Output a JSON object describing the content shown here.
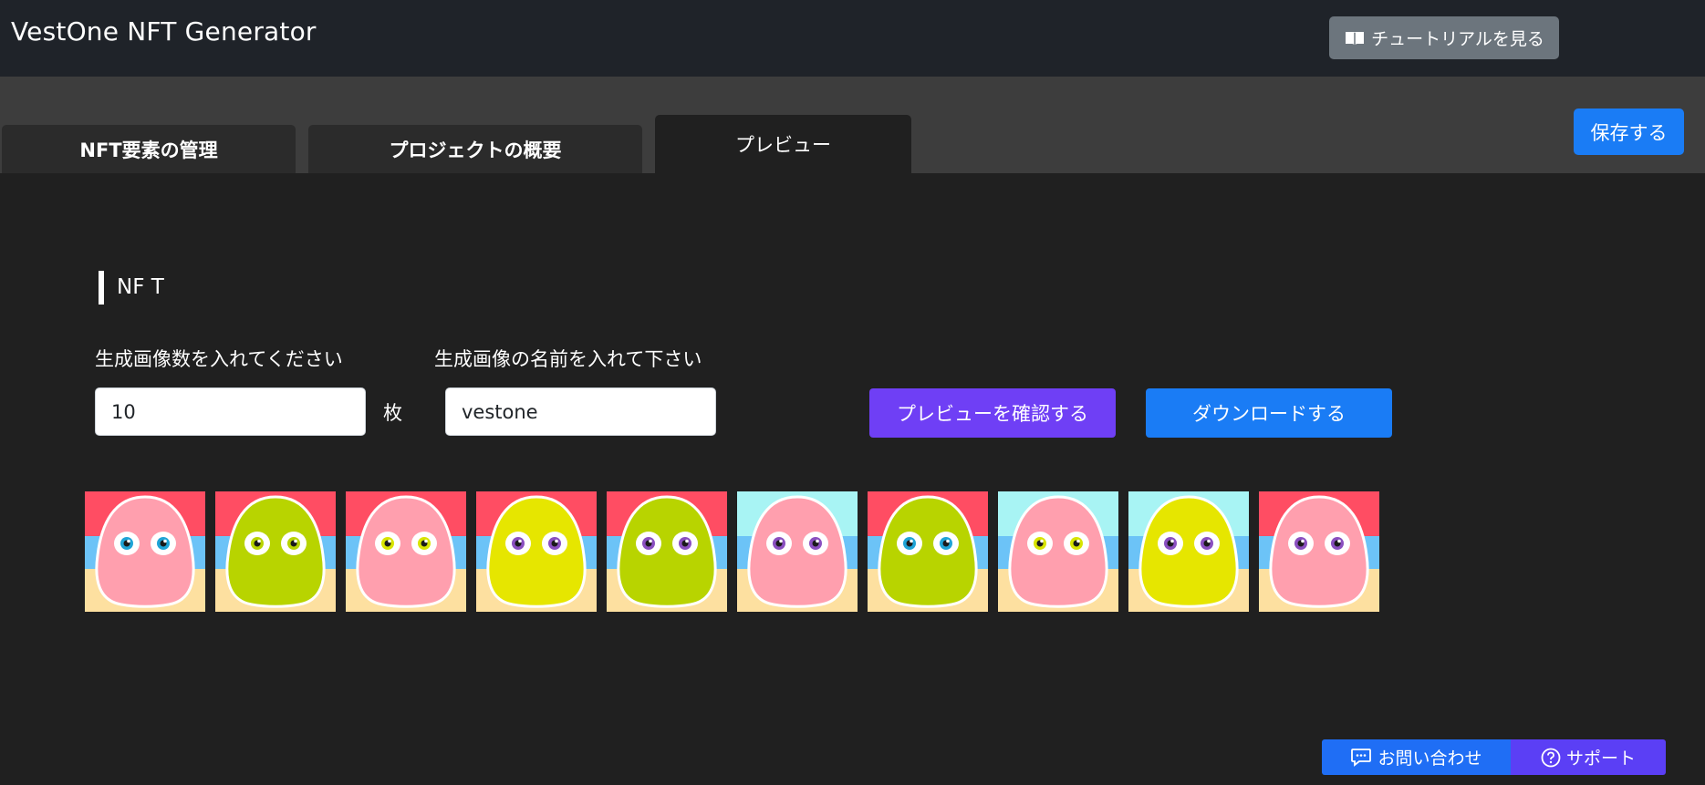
{
  "header": {
    "app_title": "VestOne NFT Generator",
    "tutorial_label": "チュートリアルを見る",
    "tutorial_icon": "book-icon"
  },
  "tabs": [
    {
      "label": "NFT要素の管理",
      "active": false
    },
    {
      "label": "プロジェクトの概要",
      "active": false
    },
    {
      "label": "プレビュー",
      "active": true
    }
  ],
  "toolbar": {
    "save_label": "保存する"
  },
  "main": {
    "section_title": "NF T",
    "count_label": "生成画像数を入れてください",
    "count_value": "10",
    "count_unit": "枚",
    "name_label": "生成画像の名前を入れて下さい",
    "name_value": "vestone",
    "preview_button": "プレビューを確認する",
    "download_button": "ダウンロードする"
  },
  "thumbnails": [
    {
      "bg_top": "#ff4d63",
      "body": "#ff9fae",
      "eye": "#1fa4d6"
    },
    {
      "bg_top": "#ff4d63",
      "body": "#b8d400",
      "eye": "#b8d400"
    },
    {
      "bg_top": "#ff4d63",
      "body": "#ff9fae",
      "eye": "#d8e400"
    },
    {
      "bg_top": "#ff4d63",
      "body": "#e6e600",
      "eye": "#8a4fc0"
    },
    {
      "bg_top": "#ff4d63",
      "body": "#b8d400",
      "eye": "#8a4fc0"
    },
    {
      "bg_top": "#a8f4f4",
      "body": "#ff9fae",
      "eye": "#8a4fc0"
    },
    {
      "bg_top": "#ff4d63",
      "body": "#b8d400",
      "eye": "#1fa4d6"
    },
    {
      "bg_top": "#a8f4f4",
      "body": "#ff9fae",
      "eye": "#d8e400"
    },
    {
      "bg_top": "#a8f4f4",
      "body": "#e6e600",
      "eye": "#8a4fc0"
    },
    {
      "bg_top": "#ff4d63",
      "body": "#ff9fae",
      "eye": "#8a4fc0"
    }
  ],
  "footer": {
    "contact_label": "お問い合わせ",
    "contact_icon": "chat-icon",
    "support_label": "サポート",
    "support_icon": "help-circle-icon"
  },
  "colors": {
    "stripe_blue": "#6cc3f7",
    "stripe_sand": "#fde0a0",
    "primary": "#1a7cf5",
    "purple": "#6f3ff5"
  }
}
